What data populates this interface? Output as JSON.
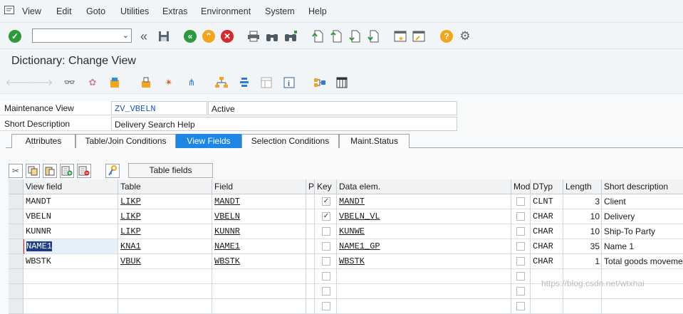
{
  "menu": {
    "items": [
      {
        "label": "View"
      },
      {
        "label": "Edit"
      },
      {
        "label": "Goto"
      },
      {
        "label": "Utilities"
      },
      {
        "label": "Extras"
      },
      {
        "label": "Environment"
      },
      {
        "label": "System"
      },
      {
        "label": "Help"
      }
    ]
  },
  "command_field": {
    "value": ""
  },
  "title": "Dictionary: Change View",
  "header": {
    "maint_view_label": "Maintenance View",
    "maint_view_value": "ZV_VBELN",
    "status": "Active",
    "short_desc_label": "Short Description",
    "short_desc_value": "Delivery Search Help"
  },
  "tabs": [
    {
      "label": "Attributes",
      "active": false
    },
    {
      "label": "Table/Join Conditions",
      "active": false
    },
    {
      "label": "View Fields",
      "active": true
    },
    {
      "label": "Selection Conditions",
      "active": false
    },
    {
      "label": "Maint.Status",
      "active": false
    }
  ],
  "grid_toolbar": {
    "table_fields_label": "Table fields"
  },
  "table": {
    "columns": [
      "View field",
      "Table",
      "Field",
      "P",
      "Key",
      "Data elem.",
      "Mod",
      "DTyp",
      "Length",
      "Short description"
    ],
    "rows": [
      {
        "view_field": "MANDT",
        "table": "LIKP",
        "field": "MANDT",
        "key": true,
        "data_elem": "MANDT",
        "dtyp": "CLNT",
        "length": "3",
        "desc": "Client"
      },
      {
        "view_field": "VBELN",
        "table": "LIKP",
        "field": "VBELN",
        "key": true,
        "data_elem": "VBELN_VL",
        "dtyp": "CHAR",
        "length": "10",
        "desc": "Delivery"
      },
      {
        "view_field": "KUNNR",
        "table": "LIKP",
        "field": "KUNNR",
        "key": false,
        "data_elem": "KUNWE",
        "dtyp": "CHAR",
        "length": "10",
        "desc": "Ship-To Party"
      },
      {
        "view_field": "NAME1",
        "table": "KNA1",
        "field": "NAME1",
        "key": false,
        "data_elem": "NAME1_GP",
        "dtyp": "CHAR",
        "length": "35",
        "desc": "Name 1"
      },
      {
        "view_field": "WBSTK",
        "table": "VBUK",
        "field": "WBSTK",
        "key": false,
        "data_elem": "WBSTK",
        "dtyp": "CHAR",
        "length": "1",
        "desc": "Total goods moveme"
      }
    ]
  },
  "watermark": "https://blog.csdn.net/wtxhai",
  "colors": {
    "accent": "#1e87e5",
    "ok_green": "#2c9a3c",
    "cancel_red": "#d9272e",
    "warning_orange": "#f3a61c"
  }
}
